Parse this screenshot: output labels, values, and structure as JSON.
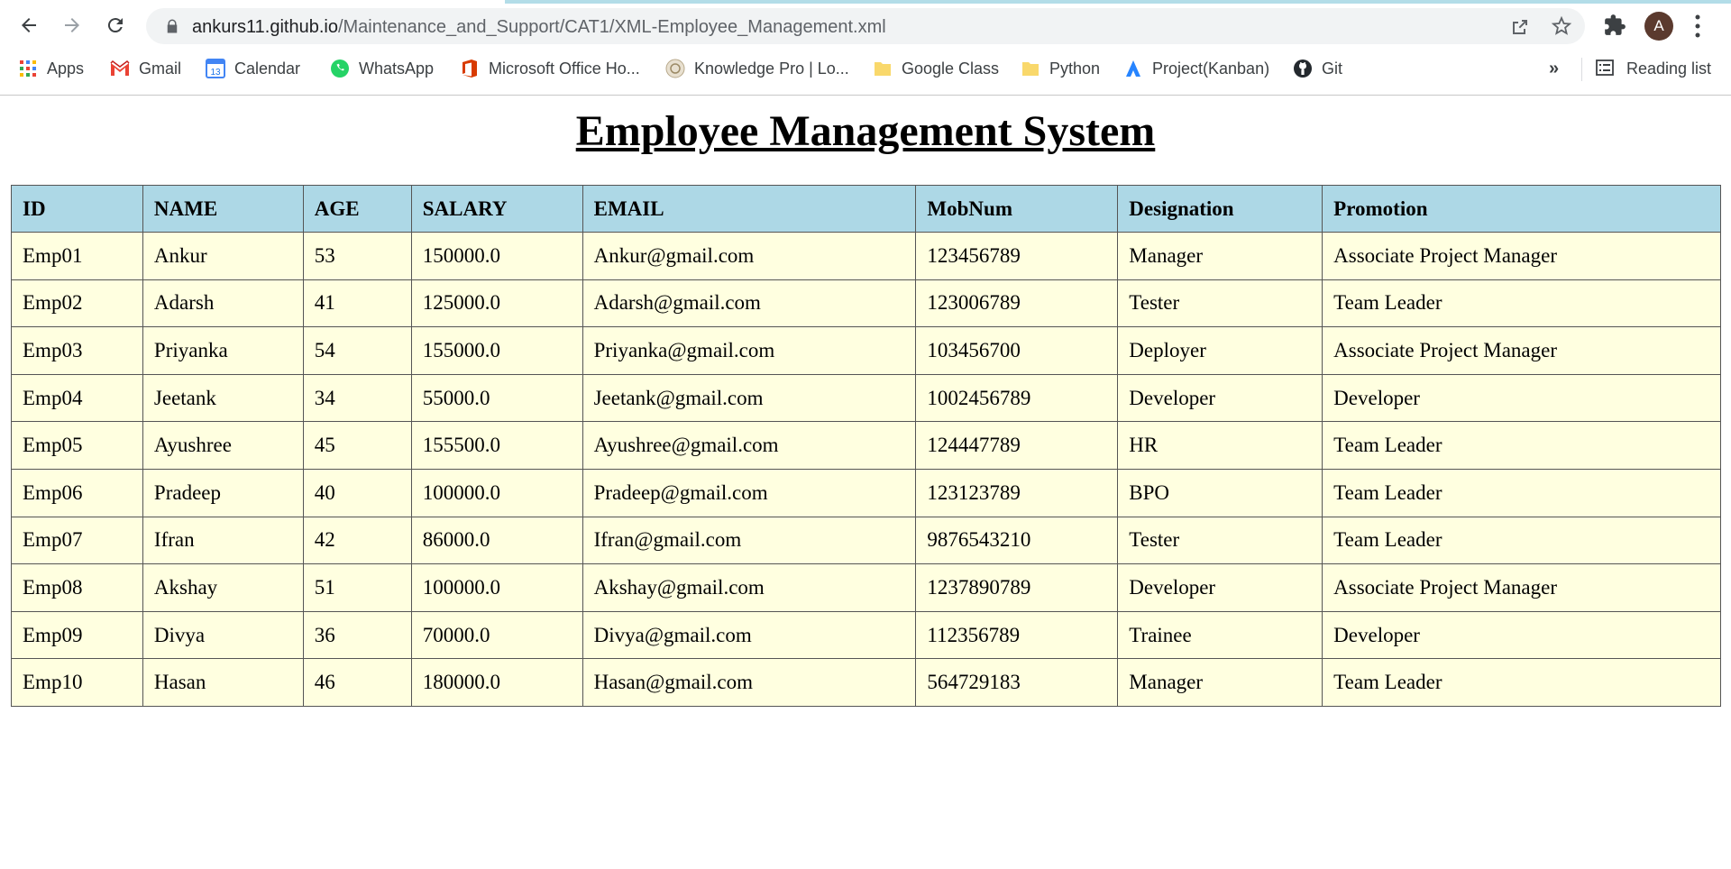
{
  "browser": {
    "url_host": "ankurs11.github.io",
    "url_path": "/Maintenance_and_Support/CAT1/XML-Employee_Management.xml",
    "profile_initial": "A",
    "bookmarks": [
      {
        "label": "Apps",
        "icon": "apps-grid-icon"
      },
      {
        "label": "Gmail",
        "icon": "gmail-icon"
      },
      {
        "label": "Calendar",
        "icon": "calendar-icon"
      },
      {
        "label": "WhatsApp",
        "icon": "whatsapp-icon"
      },
      {
        "label": "Microsoft Office Ho...",
        "icon": "office-icon"
      },
      {
        "label": "Knowledge Pro | Lo...",
        "icon": "knowledge-pro-icon"
      },
      {
        "label": "Google Class",
        "icon": "folder-icon"
      },
      {
        "label": "Python",
        "icon": "folder-icon"
      },
      {
        "label": "Project(Kanban)",
        "icon": "kanban-icon"
      },
      {
        "label": "Git",
        "icon": "github-icon"
      }
    ],
    "more_label": "»",
    "reading_list_label": "Reading list",
    "calendar_day": "13"
  },
  "page": {
    "title": "Employee Management System"
  },
  "table": {
    "headers": [
      "ID",
      "NAME",
      "AGE",
      "SALARY",
      "EMAIL",
      "MobNum",
      "Designation",
      "Promotion"
    ],
    "rows": [
      [
        "Emp01",
        "Ankur",
        "53",
        "150000.0",
        "Ankur@gmail.com",
        "123456789",
        "Manager",
        "Associate Project Manager"
      ],
      [
        "Emp02",
        "Adarsh",
        "41",
        "125000.0",
        "Adarsh@gmail.com",
        "123006789",
        "Tester",
        "Team Leader"
      ],
      [
        "Emp03",
        "Priyanka",
        "54",
        "155000.0",
        "Priyanka@gmail.com",
        "103456700",
        "Deployer",
        "Associate Project Manager"
      ],
      [
        "Emp04",
        "Jeetank",
        "34",
        "55000.0",
        "Jeetank@gmail.com",
        "1002456789",
        "Developer",
        "Developer"
      ],
      [
        "Emp05",
        "Ayushree",
        "45",
        "155500.0",
        "Ayushree@gmail.com",
        "124447789",
        "HR",
        "Team Leader"
      ],
      [
        "Emp06",
        "Pradeep",
        "40",
        "100000.0",
        "Pradeep@gmail.com",
        "123123789",
        "BPO",
        "Team Leader"
      ],
      [
        "Emp07",
        "Ifran",
        "42",
        "86000.0",
        "Ifran@gmail.com",
        "9876543210",
        "Tester",
        "Team Leader"
      ],
      [
        "Emp08",
        "Akshay",
        "51",
        "100000.0",
        "Akshay@gmail.com",
        "1237890789",
        "Developer",
        "Associate Project Manager"
      ],
      [
        "Emp09",
        "Divya",
        "36",
        "70000.0",
        "Divya@gmail.com",
        "112356789",
        "Trainee",
        "Developer"
      ],
      [
        "Emp10",
        "Hasan",
        "46",
        "180000.0",
        "Hasan@gmail.com",
        "564729183",
        "Manager",
        "Team Leader"
      ]
    ]
  },
  "colors": {
    "header_bg": "#add8e6",
    "row_bg": "#ffffe0",
    "border": "#555555"
  }
}
